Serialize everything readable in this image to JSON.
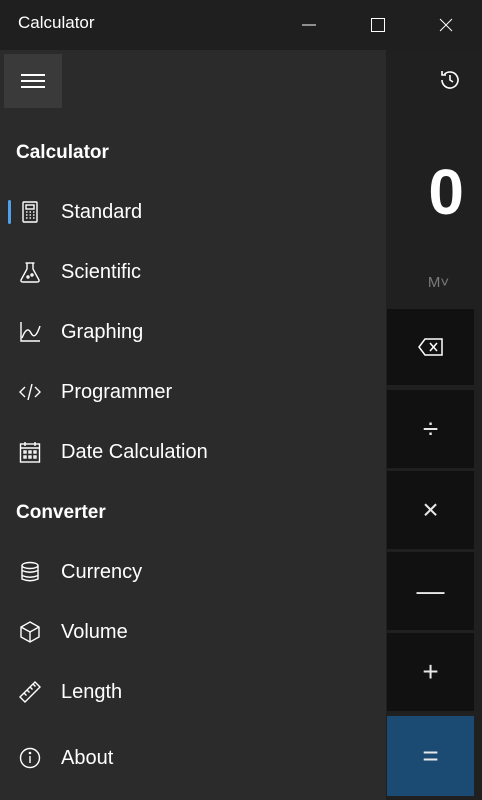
{
  "window": {
    "title": "Calculator",
    "minimize_icon": "minimize-icon",
    "maximize_icon": "maximize-icon",
    "close_icon": "close-icon"
  },
  "calculator": {
    "display_value": "0",
    "memory_label": "M˅",
    "operators": {
      "backspace_icon": "backspace-icon",
      "divide": "÷",
      "multiply": "×",
      "minus": "—",
      "plus": "+",
      "equals": "="
    }
  },
  "nav": {
    "sections": [
      {
        "header": "Calculator",
        "items": [
          {
            "label": "Standard",
            "icon": "standard-calculator-icon",
            "selected": true
          },
          {
            "label": "Scientific",
            "icon": "flask-icon"
          },
          {
            "label": "Graphing",
            "icon": "graph-icon"
          },
          {
            "label": "Programmer",
            "icon": "code-icon"
          },
          {
            "label": "Date Calculation",
            "icon": "calendar-icon"
          }
        ]
      },
      {
        "header": "Converter",
        "items": [
          {
            "label": "Currency",
            "icon": "currency-icon"
          },
          {
            "label": "Volume",
            "icon": "volume-cube-icon"
          },
          {
            "label": "Length",
            "icon": "ruler-icon"
          }
        ]
      }
    ],
    "about": {
      "label": "About",
      "icon": "info-icon"
    }
  },
  "colors": {
    "accent": "#4ea1e8",
    "equals_bg": "#1b4b72",
    "nav_bg": "#2b2b2b",
    "app_bg": "#1f1f1f"
  }
}
